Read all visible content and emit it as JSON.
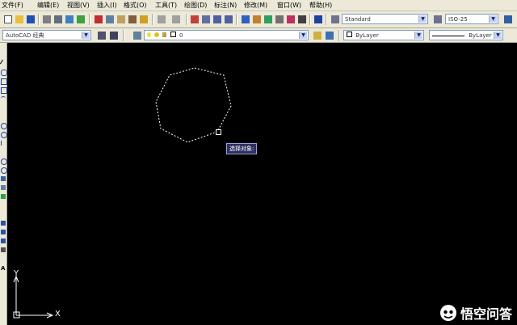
{
  "menu": [
    {
      "label": "文件(F)"
    },
    {
      "label": "编辑(E)"
    },
    {
      "label": "视图(V)"
    },
    {
      "label": "插入(I)"
    },
    {
      "label": "格式(O)"
    },
    {
      "label": "工具(T)"
    },
    {
      "label": "绘图(D)"
    },
    {
      "label": "标注(N)"
    },
    {
      "label": "修改(M)"
    },
    {
      "label": "窗口(W)"
    },
    {
      "label": "帮助(H)"
    }
  ],
  "toolbar": {
    "text_style": "Standard",
    "dim_style": "ISO-25"
  },
  "toolbar2": {
    "workspace": "AutoCAD 经典",
    "layer": "0",
    "color": "ByLayer",
    "linetype": "ByLayer"
  },
  "canvas": {
    "tooltip": "选择对象:",
    "ucs_y": "Y",
    "ucs_x": "X"
  },
  "watermark": {
    "text": "悟空问答"
  },
  "colors": {
    "canvas_bg": "#000000",
    "toolbar_bg": "#ece9d8",
    "tooltip_bg": "#303060"
  }
}
